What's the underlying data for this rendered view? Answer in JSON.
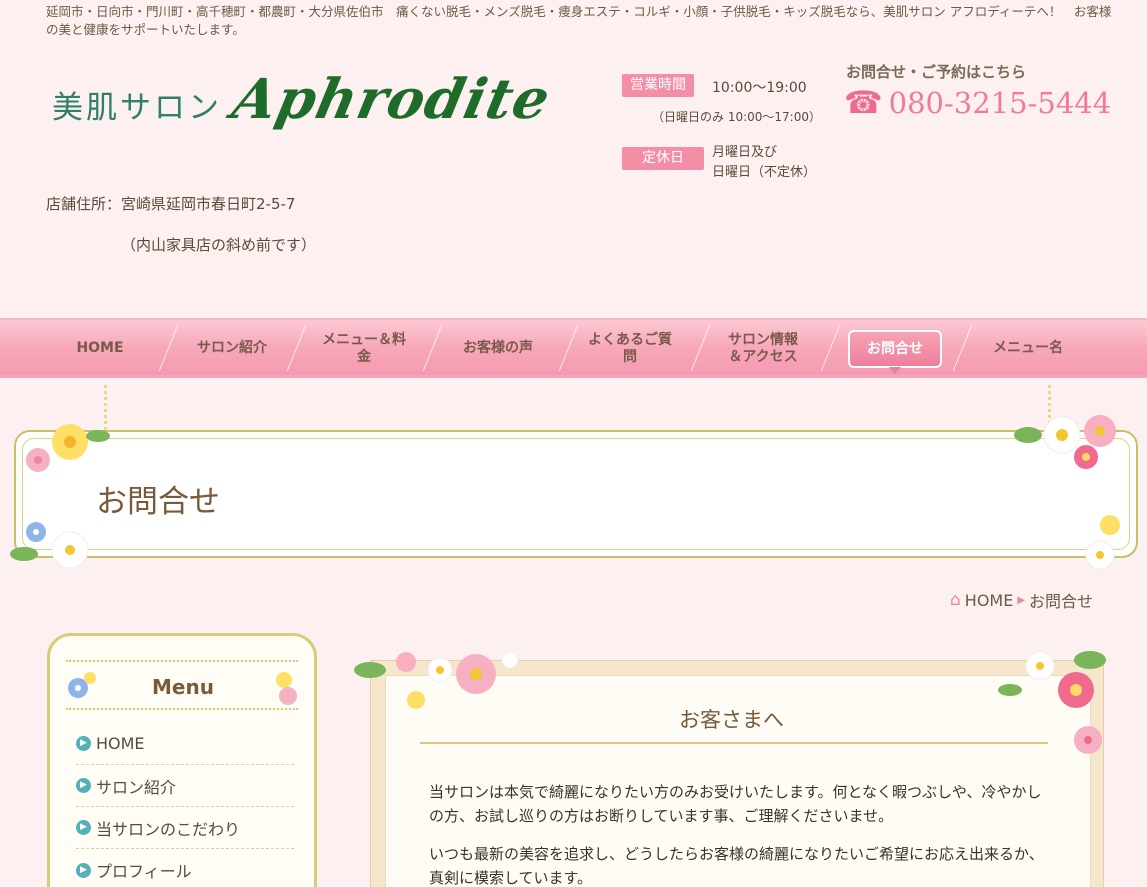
{
  "header": {
    "tagline": "延岡市・日向市・門川町・高千穂町・都農町・大分県佐伯市　痛くない脱毛・メンズ脱毛・痩身エステ・コルギ・小顔・子供脱毛・キッズ脱毛なら、美肌サロン アフロディーテへ！　お客様の美と健康をサポートいたします。",
    "logo_jp": "美肌サロン",
    "logo_en": "Aphrodite",
    "hours_label": "営業時間",
    "hours_value": "10:00～19:00",
    "hours_note": "（日曜日のみ 10:00～17:00）",
    "closed_label": "定休日",
    "closed_line1": "月曜日及び",
    "closed_line2": "日曜日（不定休）",
    "contact_heading": "お問合せ・ご予約はこちら",
    "phone_icon": "telephone-icon",
    "phone": "080-3215-5444",
    "address": "店舗住所：宮崎県延岡市春日町2-5-7",
    "address_note": "（内山家具店の斜め前です）"
  },
  "nav": {
    "items": [
      {
        "label": "HOME"
      },
      {
        "label": "サロン紹介"
      },
      {
        "label": "メニュー＆料\n金"
      },
      {
        "label": "お客様の声"
      },
      {
        "label": "よくあるご質\n問"
      },
      {
        "label": "サロン情報\n＆アクセス"
      },
      {
        "label": "お問合せ"
      },
      {
        "label": "メニュー名"
      }
    ],
    "active": "お問合せ"
  },
  "page": {
    "title": "お問合せ"
  },
  "breadcrumb": {
    "home": "HOME",
    "current": "お問合せ"
  },
  "sidebar": {
    "title": "Menu",
    "items": [
      {
        "label": "HOME"
      },
      {
        "label": "サロン紹介"
      },
      {
        "label": "当サロンのこだわり"
      },
      {
        "label": "プロフィール"
      }
    ]
  },
  "content": {
    "title": "お客さまへ",
    "paragraph1": "当サロンは本気で綺麗になりたい方のみお受けいたします。何となく暇つぶしや、冷やかしの方、お試し巡りの方はお断りしています事、ご理解くださいませ。",
    "paragraph2": "いつも最新の美容を追求し、どうしたらお客様の綺麗になりたいご希望にお応え出来るか、真剣に模索しています。"
  },
  "colors": {
    "pink": "#f28ea6",
    "nav_pink": "#f7a8ba",
    "logo_green": "#1f6b2a",
    "gold_border": "#c9bf66"
  }
}
